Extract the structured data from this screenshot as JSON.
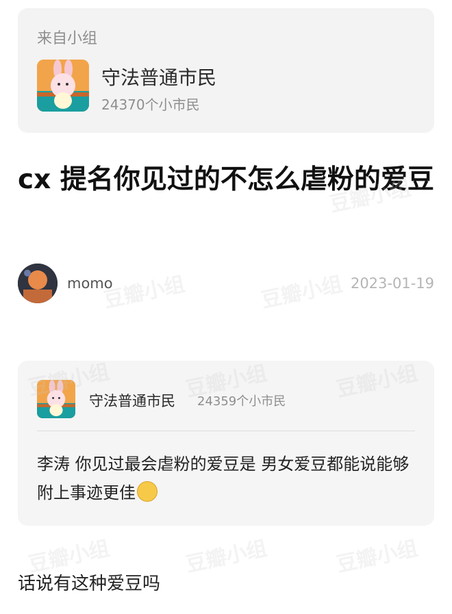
{
  "group_card": {
    "from_label": "来自小组",
    "group_name": "守法普通市民",
    "member_count": "24370个小市民",
    "avatar_icon": "bunny-mascot-icon"
  },
  "post": {
    "title": "cx 提名你见过的不怎么虐粉的爱豆",
    "author": "momo",
    "date": "2023-01-19",
    "body": "话说有这种爱豆吗"
  },
  "quote_card": {
    "group_name": "守法普通市民",
    "member_count": "24359个小市民",
    "text": "李涛 你见过最会虐粉的爱豆是 男女爱豆都能说能够附上事迹更佳",
    "emoji": "smiling-face-icon"
  },
  "watermark": "豆瓣小组",
  "colors": {
    "card_bg": "#f3f3f3",
    "muted_text": "#8e8e8e",
    "date_text": "#b5b5b5",
    "title_text": "#111111"
  }
}
